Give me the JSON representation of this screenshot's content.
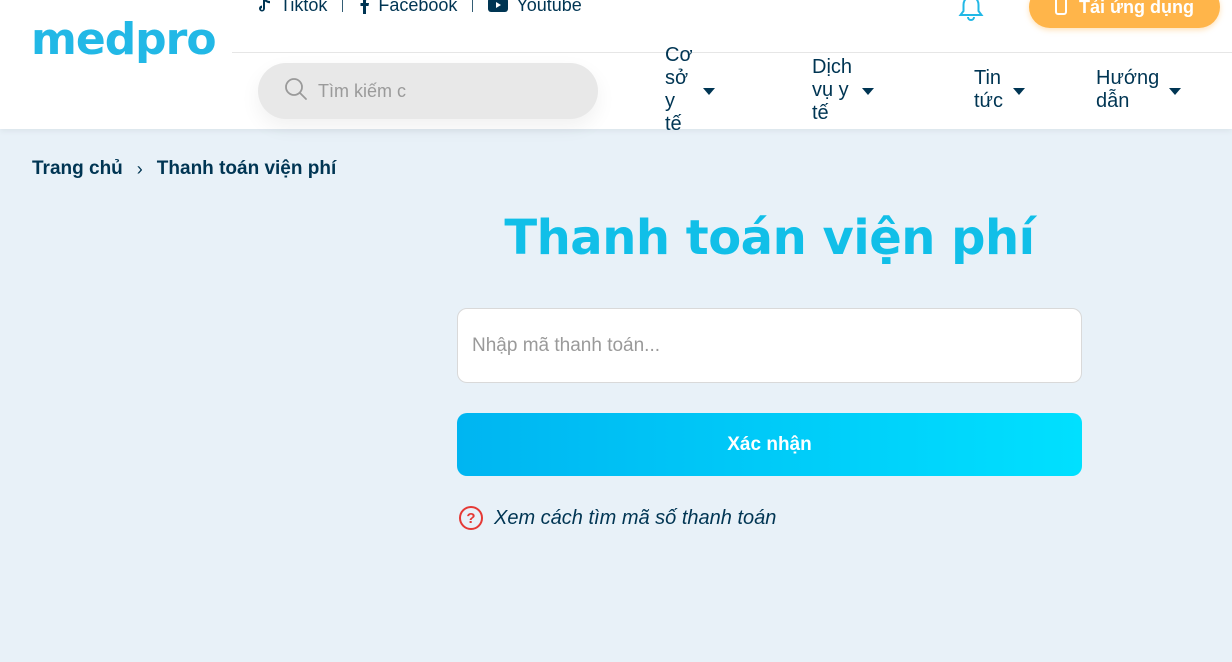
{
  "brand": {
    "logo_text": "medpro",
    "color": "#22b8e6"
  },
  "social": [
    {
      "label": "Tiktok",
      "icon": "tiktok-icon"
    },
    {
      "label": "Facebook",
      "icon": "facebook-icon"
    },
    {
      "label": "Youtube",
      "icon": "youtube-icon"
    }
  ],
  "header": {
    "notification_icon": "bell-icon",
    "app_button_label": "Tải ứng dụng",
    "app_button_icon": "phone-icon"
  },
  "search": {
    "placeholder": "Tìm kiếm c",
    "icon": "search-icon"
  },
  "nav": [
    {
      "label": "Cơ sở y tế"
    },
    {
      "label": "Dịch vụ y tế"
    },
    {
      "label": "Tin tức"
    },
    {
      "label": "Hướng dẫn"
    }
  ],
  "breadcrumb": {
    "home": "Trang chủ",
    "separator": "›",
    "current": "Thanh toán viện phí"
  },
  "main": {
    "title": "Thanh toán viện phí",
    "input_placeholder": "Nhập mã thanh toán...",
    "confirm_label": "Xác nhận",
    "help_icon_glyph": "?",
    "help_text": "Xem cách tìm mã số thanh toán"
  },
  "colors": {
    "accent": "#11bfe8",
    "navy": "#003553",
    "orange": "#ffb54a",
    "error": "#e53935"
  }
}
